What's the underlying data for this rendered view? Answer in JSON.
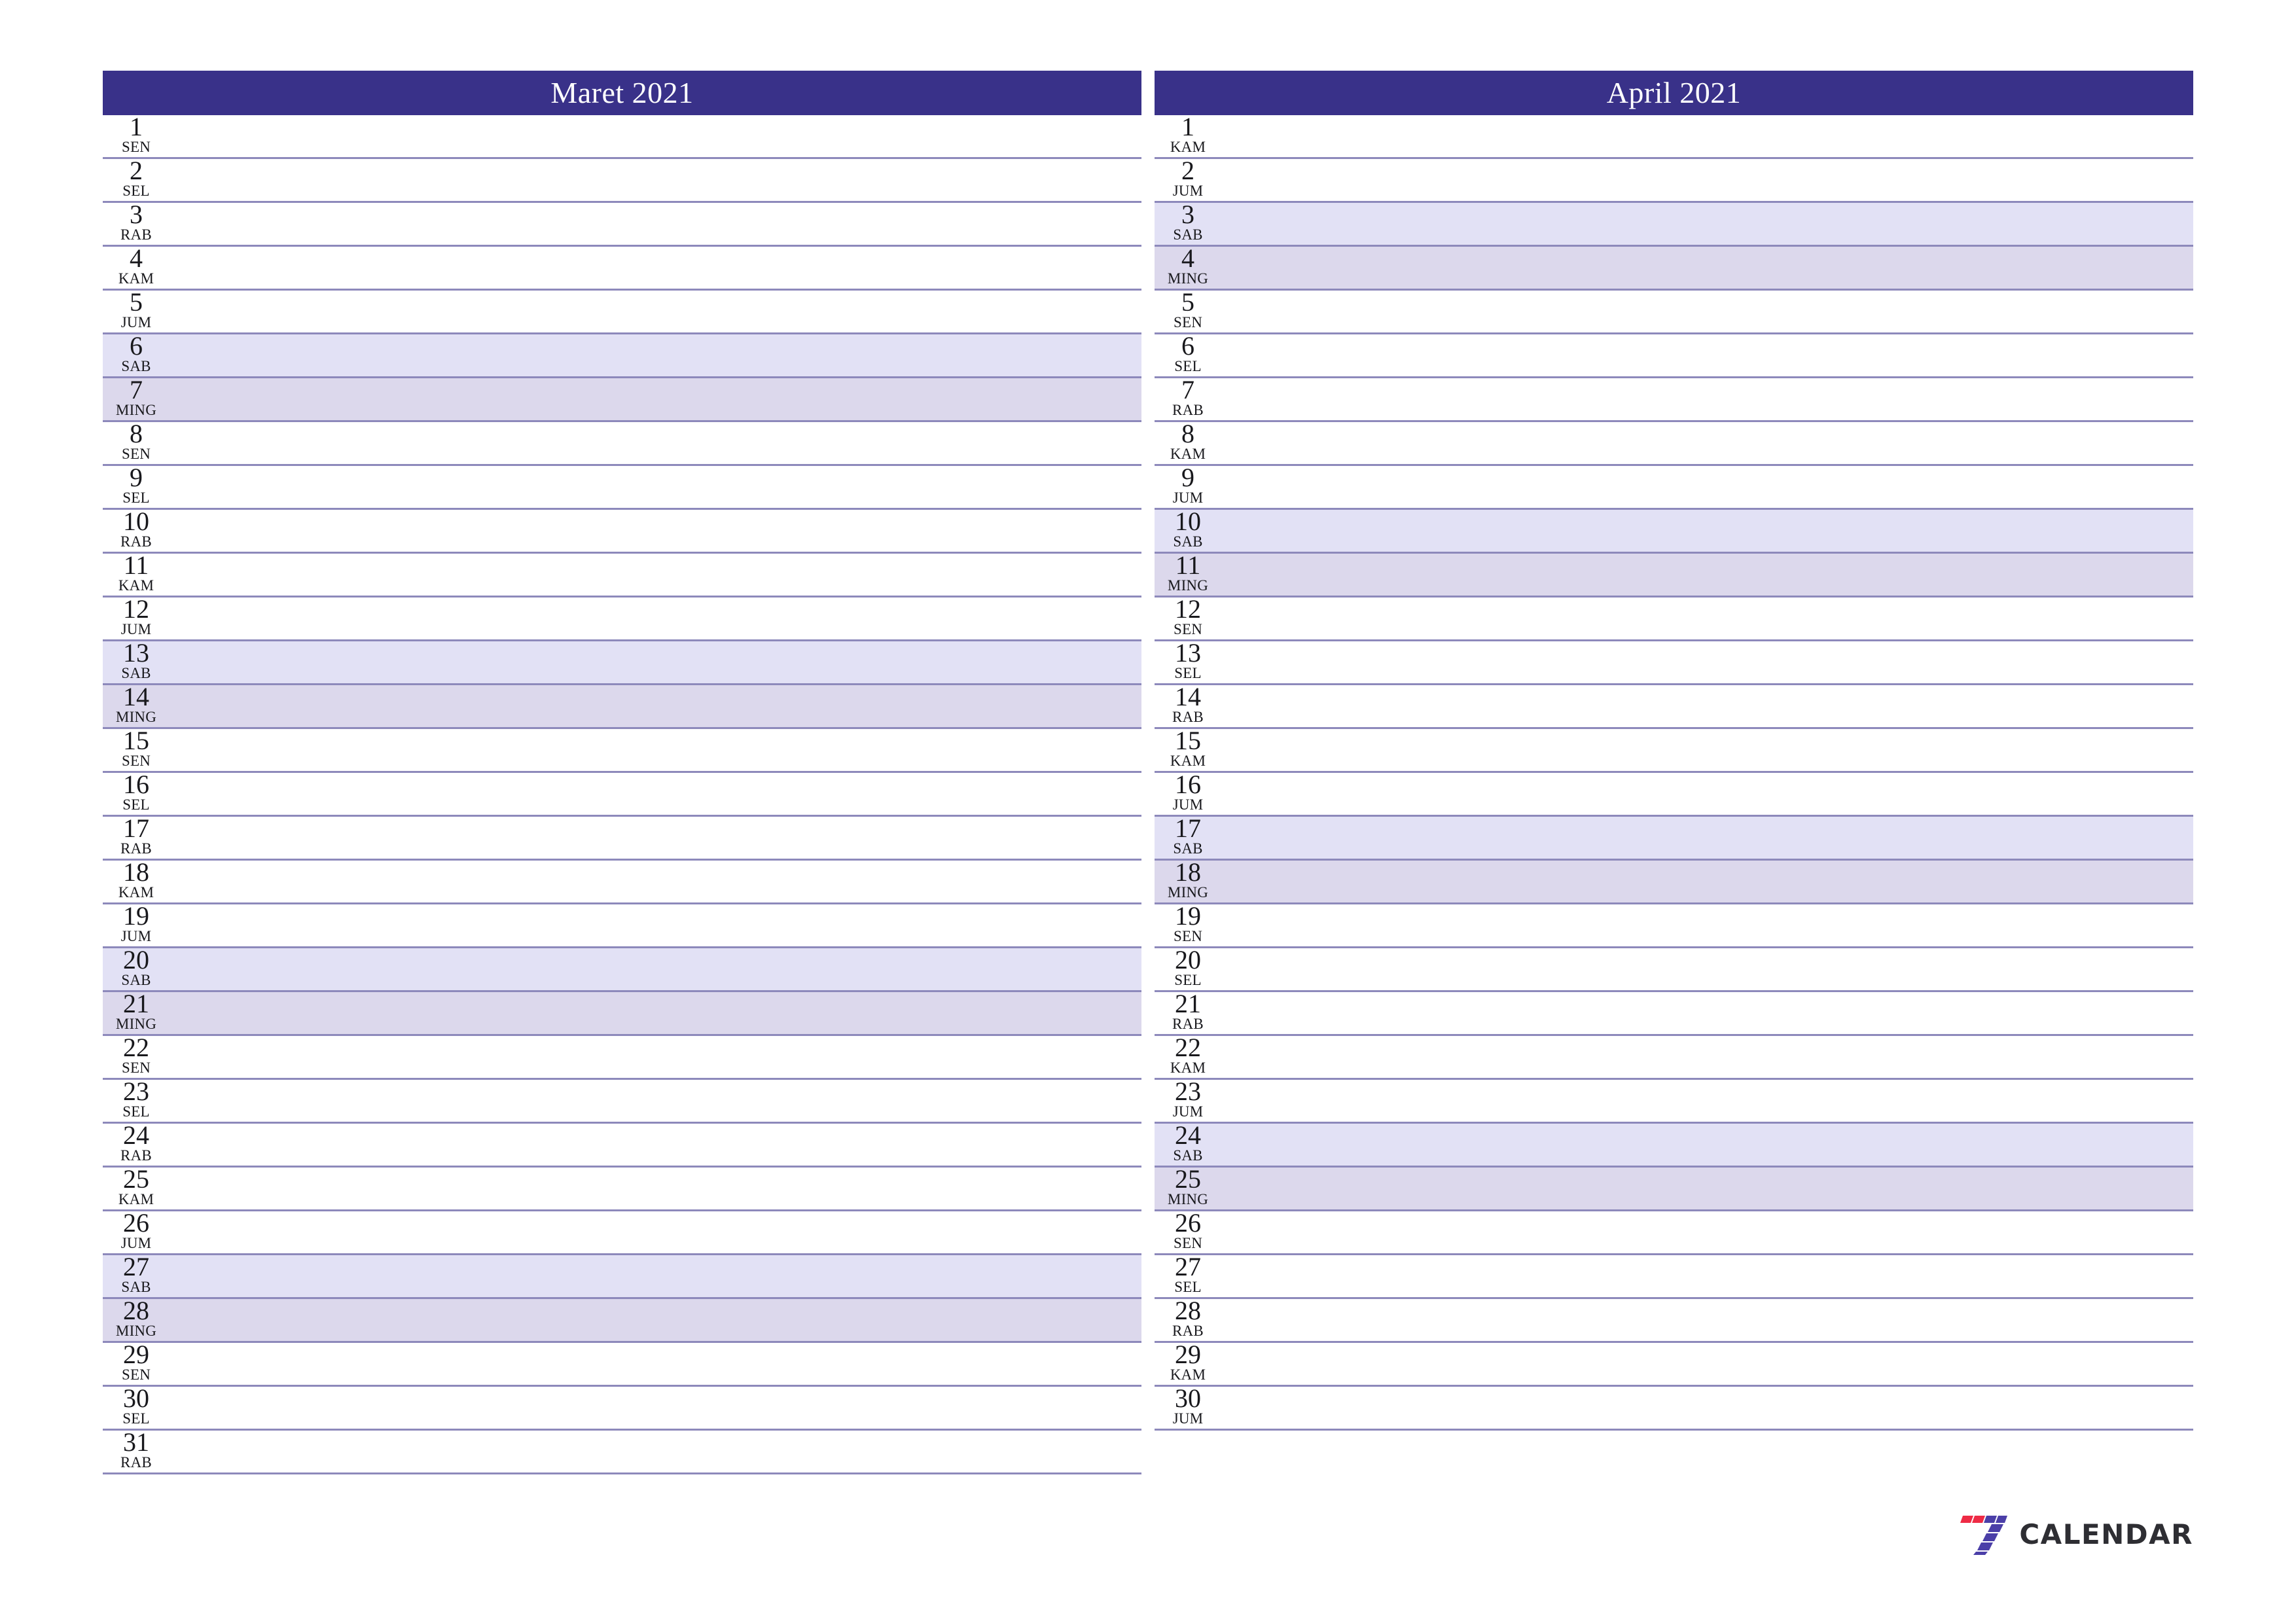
{
  "document": {
    "type": "printable-monthly-planner",
    "language": "id",
    "page_background": "#ffffff"
  },
  "colors": {
    "header_bar": "#393189",
    "header_text": "#ffffff",
    "row_divider": "#8d89bb",
    "saturday_fill": "#e2e1f5",
    "sunday_fill": "#dcd8ec",
    "day_text": "#18181c",
    "logo_red": "#ee2b45",
    "logo_purple": "#4b3fa8",
    "logo_wordmark": "#2e2e33"
  },
  "months": [
    {
      "title": "Maret 2021",
      "days": [
        {
          "num": "1",
          "abbr": "SEN",
          "type": "weekday"
        },
        {
          "num": "2",
          "abbr": "SEL",
          "type": "weekday"
        },
        {
          "num": "3",
          "abbr": "RAB",
          "type": "weekday"
        },
        {
          "num": "4",
          "abbr": "KAM",
          "type": "weekday"
        },
        {
          "num": "5",
          "abbr": "JUM",
          "type": "weekday"
        },
        {
          "num": "6",
          "abbr": "SAB",
          "type": "saturday"
        },
        {
          "num": "7",
          "abbr": "MING",
          "type": "sunday"
        },
        {
          "num": "8",
          "abbr": "SEN",
          "type": "weekday"
        },
        {
          "num": "9",
          "abbr": "SEL",
          "type": "weekday"
        },
        {
          "num": "10",
          "abbr": "RAB",
          "type": "weekday"
        },
        {
          "num": "11",
          "abbr": "KAM",
          "type": "weekday"
        },
        {
          "num": "12",
          "abbr": "JUM",
          "type": "weekday"
        },
        {
          "num": "13",
          "abbr": "SAB",
          "type": "saturday"
        },
        {
          "num": "14",
          "abbr": "MING",
          "type": "sunday"
        },
        {
          "num": "15",
          "abbr": "SEN",
          "type": "weekday"
        },
        {
          "num": "16",
          "abbr": "SEL",
          "type": "weekday"
        },
        {
          "num": "17",
          "abbr": "RAB",
          "type": "weekday"
        },
        {
          "num": "18",
          "abbr": "KAM",
          "type": "weekday"
        },
        {
          "num": "19",
          "abbr": "JUM",
          "type": "weekday"
        },
        {
          "num": "20",
          "abbr": "SAB",
          "type": "saturday"
        },
        {
          "num": "21",
          "abbr": "MING",
          "type": "sunday"
        },
        {
          "num": "22",
          "abbr": "SEN",
          "type": "weekday"
        },
        {
          "num": "23",
          "abbr": "SEL",
          "type": "weekday"
        },
        {
          "num": "24",
          "abbr": "RAB",
          "type": "weekday"
        },
        {
          "num": "25",
          "abbr": "KAM",
          "type": "weekday"
        },
        {
          "num": "26",
          "abbr": "JUM",
          "type": "weekday"
        },
        {
          "num": "27",
          "abbr": "SAB",
          "type": "saturday"
        },
        {
          "num": "28",
          "abbr": "MING",
          "type": "sunday"
        },
        {
          "num": "29",
          "abbr": "SEN",
          "type": "weekday"
        },
        {
          "num": "30",
          "abbr": "SEL",
          "type": "weekday"
        },
        {
          "num": "31",
          "abbr": "RAB",
          "type": "weekday"
        }
      ]
    },
    {
      "title": "April 2021",
      "days": [
        {
          "num": "1",
          "abbr": "KAM",
          "type": "weekday"
        },
        {
          "num": "2",
          "abbr": "JUM",
          "type": "weekday"
        },
        {
          "num": "3",
          "abbr": "SAB",
          "type": "saturday"
        },
        {
          "num": "4",
          "abbr": "MING",
          "type": "sunday"
        },
        {
          "num": "5",
          "abbr": "SEN",
          "type": "weekday"
        },
        {
          "num": "6",
          "abbr": "SEL",
          "type": "weekday"
        },
        {
          "num": "7",
          "abbr": "RAB",
          "type": "weekday"
        },
        {
          "num": "8",
          "abbr": "KAM",
          "type": "weekday"
        },
        {
          "num": "9",
          "abbr": "JUM",
          "type": "weekday"
        },
        {
          "num": "10",
          "abbr": "SAB",
          "type": "saturday"
        },
        {
          "num": "11",
          "abbr": "MING",
          "type": "sunday"
        },
        {
          "num": "12",
          "abbr": "SEN",
          "type": "weekday"
        },
        {
          "num": "13",
          "abbr": "SEL",
          "type": "weekday"
        },
        {
          "num": "14",
          "abbr": "RAB",
          "type": "weekday"
        },
        {
          "num": "15",
          "abbr": "KAM",
          "type": "weekday"
        },
        {
          "num": "16",
          "abbr": "JUM",
          "type": "weekday"
        },
        {
          "num": "17",
          "abbr": "SAB",
          "type": "saturday"
        },
        {
          "num": "18",
          "abbr": "MING",
          "type": "sunday"
        },
        {
          "num": "19",
          "abbr": "SEN",
          "type": "weekday"
        },
        {
          "num": "20",
          "abbr": "SEL",
          "type": "weekday"
        },
        {
          "num": "21",
          "abbr": "RAB",
          "type": "weekday"
        },
        {
          "num": "22",
          "abbr": "KAM",
          "type": "weekday"
        },
        {
          "num": "23",
          "abbr": "JUM",
          "type": "weekday"
        },
        {
          "num": "24",
          "abbr": "SAB",
          "type": "saturday"
        },
        {
          "num": "25",
          "abbr": "MING",
          "type": "sunday"
        },
        {
          "num": "26",
          "abbr": "SEN",
          "type": "weekday"
        },
        {
          "num": "27",
          "abbr": "SEL",
          "type": "weekday"
        },
        {
          "num": "28",
          "abbr": "RAB",
          "type": "weekday"
        },
        {
          "num": "29",
          "abbr": "KAM",
          "type": "weekday"
        },
        {
          "num": "30",
          "abbr": "JUM",
          "type": "weekday"
        }
      ]
    }
  ],
  "footer": {
    "logo_mark_name": "seven-logo-icon",
    "logo_text": "CALENDAR"
  }
}
